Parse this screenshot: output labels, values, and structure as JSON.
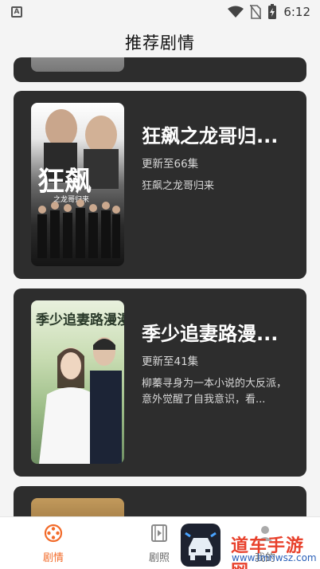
{
  "status_bar": {
    "left_icon": "A",
    "time": "6:12",
    "icons": [
      "wifi-icon",
      "no-sim-icon",
      "battery-charging-icon"
    ]
  },
  "header": {
    "title": "推荐剧情"
  },
  "cards": [
    {
      "title": "狂飙之龙哥归...",
      "episodes": "更新至66集",
      "description": "狂飙之龙哥归来",
      "poster_text": "狂飙",
      "poster_subtext": "之龙哥归来"
    },
    {
      "title": "季少追妻路漫...",
      "episodes": "更新至41集",
      "description": "柳蓁寻身为一本小说的大反派，意外觉醒了自我意识，看...",
      "poster_text": "季少追妻路漫漫"
    }
  ],
  "bottom_nav": [
    {
      "label": "剧情",
      "icon": "film-reel-icon",
      "active": true
    },
    {
      "label": "剧照",
      "icon": "film-strip-icon",
      "active": false
    },
    {
      "label": "我的",
      "icon": "user-icon",
      "active": false
    }
  ],
  "watermark": {
    "text": "道车手游网",
    "url": "www.lmnwsz.com"
  },
  "colors": {
    "accent": "#f26b2a",
    "card_bg": "#2d2d2d",
    "page_bg": "#f4f4f4"
  }
}
